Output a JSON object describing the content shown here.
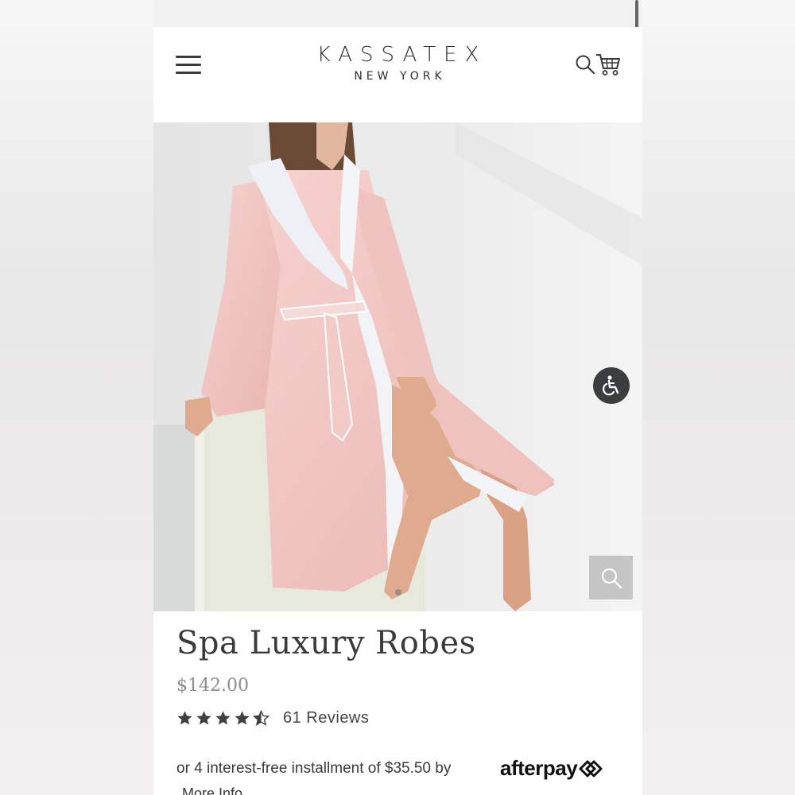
{
  "header": {
    "brand_name": "KASSATEX",
    "brand_sub": "NEW YORK"
  },
  "product": {
    "title": "Spa Luxury Robes",
    "price": "$142.00",
    "rating": 4.5,
    "rating_max": 5,
    "reviews_label": "61 Reviews"
  },
  "afterpay": {
    "text": "or 4 interest-free installment of $35.50 by",
    "logo": "afterpay",
    "more_info": "More Info"
  },
  "colors": {
    "robe": "#f1c6c3",
    "lapel": "#eef0f5",
    "background_photo": "#ebebeb",
    "text_primary": "#3b3b3b",
    "text_price": "#8c8c8c"
  },
  "icons": [
    "hamburger-menu-icon",
    "search-icon",
    "cart-icon",
    "accessibility-icon",
    "zoom-icon",
    "star-icon"
  ],
  "gallery": {
    "current_slide": 1
  }
}
